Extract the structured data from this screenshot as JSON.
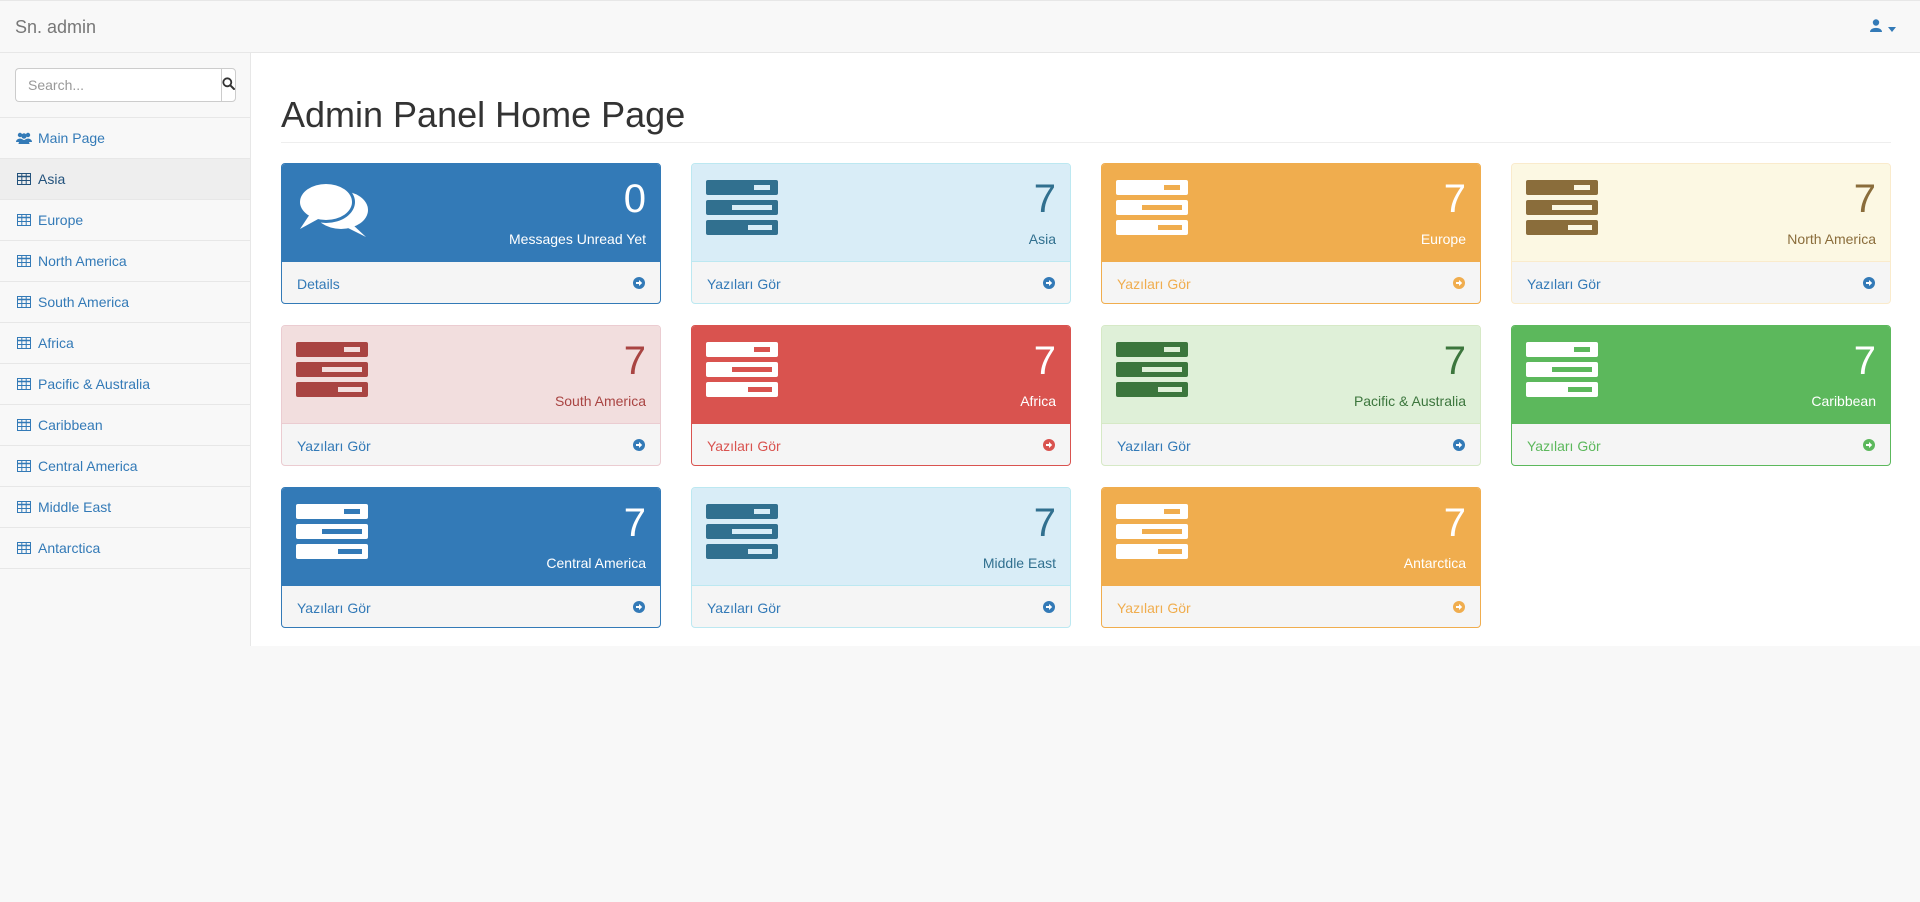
{
  "navbar": {
    "brand": "Sn. admin",
    "user_icon": "user-icon",
    "caret_icon": "caret-down-icon"
  },
  "sidebar": {
    "search": {
      "placeholder": "Search...",
      "value": "",
      "button_icon": "search-icon"
    },
    "items": [
      {
        "label": "Main Page",
        "icon": "users-icon"
      },
      {
        "label": "Asia",
        "icon": "table-icon",
        "active": true
      },
      {
        "label": "Europe",
        "icon": "table-icon"
      },
      {
        "label": "North America",
        "icon": "table-icon"
      },
      {
        "label": "South America",
        "icon": "table-icon"
      },
      {
        "label": "Africa",
        "icon": "table-icon"
      },
      {
        "label": "Pacific & Australia",
        "icon": "table-icon"
      },
      {
        "label": "Caribbean",
        "icon": "table-icon"
      },
      {
        "label": "Central America",
        "icon": "table-icon"
      },
      {
        "label": "Middle East",
        "icon": "table-icon"
      },
      {
        "label": "Antarctica",
        "icon": "table-icon"
      }
    ]
  },
  "main": {
    "title": "Admin Panel Home Page",
    "panels": [
      {
        "count": "0",
        "label": "Messages Unread Yet",
        "footer": "Details",
        "icon": "comments-icon",
        "style": "primary"
      },
      {
        "count": "7",
        "label": "Asia",
        "footer": "Yazıları Gör",
        "icon": "server-icon",
        "style": "info"
      },
      {
        "count": "7",
        "label": "Europe",
        "footer": "Yazıları Gör",
        "icon": "server-icon",
        "style": "yellow"
      },
      {
        "count": "7",
        "label": "North America",
        "footer": "Yazıları Gör",
        "icon": "server-icon",
        "style": "warning"
      },
      {
        "count": "7",
        "label": "South America",
        "footer": "Yazıları Gör",
        "icon": "server-icon",
        "style": "danger"
      },
      {
        "count": "7",
        "label": "Africa",
        "footer": "Yazıları Gör",
        "icon": "server-icon",
        "style": "red"
      },
      {
        "count": "7",
        "label": "Pacific & Australia",
        "footer": "Yazıları Gör",
        "icon": "server-icon",
        "style": "success"
      },
      {
        "count": "7",
        "label": "Caribbean",
        "footer": "Yazıları Gör",
        "icon": "server-icon",
        "style": "green"
      },
      {
        "count": "7",
        "label": "Central America",
        "footer": "Yazıları Gör",
        "icon": "server-icon",
        "style": "primary"
      },
      {
        "count": "7",
        "label": "Middle East",
        "footer": "Yazıları Gör",
        "icon": "server-icon",
        "style": "info"
      },
      {
        "count": "7",
        "label": "Antarctica",
        "footer": "Yazıları Gör",
        "icon": "server-icon",
        "style": "yellow"
      }
    ],
    "footer_arrow_icon": "arrow-circle-right-icon"
  },
  "colors": {
    "primary": "#337ab7",
    "info_bg": "#d9edf7",
    "info_text": "#31708f",
    "yellow": "#f0ad4e",
    "warning_bg": "#fcf8e3",
    "warning_text": "#8a6d3b",
    "danger_bg": "#f2dede",
    "danger_text": "#a94442",
    "red": "#d9534f",
    "success_bg": "#dff0d8",
    "success_text": "#3c763d",
    "green": "#5cb85c"
  }
}
